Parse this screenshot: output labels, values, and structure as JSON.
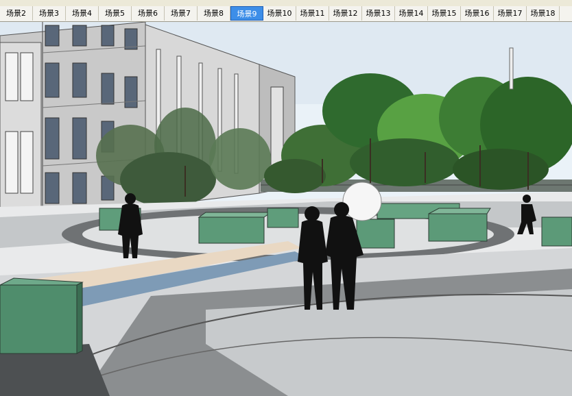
{
  "scene_tabs": {
    "items": [
      {
        "label": "场景2"
      },
      {
        "label": "场景3"
      },
      {
        "label": "场景4"
      },
      {
        "label": "场景5"
      },
      {
        "label": "场景6"
      },
      {
        "label": "场景7"
      },
      {
        "label": "场景8"
      },
      {
        "label": "场景9",
        "active": true
      },
      {
        "label": "场景10"
      },
      {
        "label": "场景11"
      },
      {
        "label": "场景12"
      },
      {
        "label": "场景13"
      },
      {
        "label": "场景14"
      },
      {
        "label": "场景15"
      },
      {
        "label": "场景16"
      },
      {
        "label": "场景17"
      },
      {
        "label": "场景18"
      }
    ],
    "active_index": 7
  },
  "colors": {
    "tab_active_bg": "#3d8ee8",
    "tab_active_text": "#ffffff",
    "sky": "#e8f1f8",
    "plaza_paving": "#8a8c8e",
    "planter_green": "#5c9a7a",
    "silhouette": "#111111"
  },
  "viewport": {
    "description_icon": "3d-model-view-icon"
  }
}
